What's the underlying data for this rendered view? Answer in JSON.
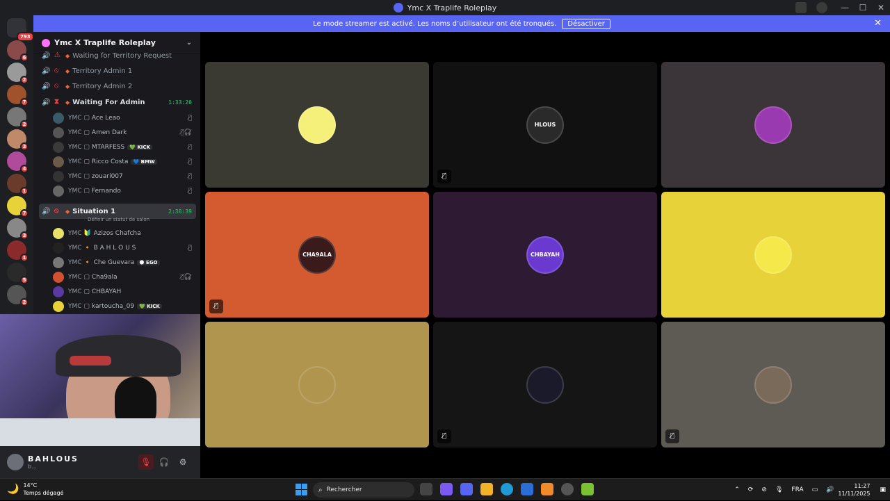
{
  "window": {
    "title": "Ymc X Traplife Roleplay"
  },
  "banner": {
    "message": "Le mode streamer est activé. Les noms d’utilisateur ont été tronqués.",
    "button": "Désactiver"
  },
  "rail": {
    "home_badge": "793",
    "servers": [
      {
        "badge": "6",
        "color": "#8a4a4a"
      },
      {
        "badge": "2",
        "color": "#9a9a9a"
      },
      {
        "badge": "7",
        "color": "#a0522d"
      },
      {
        "badge": "2",
        "color": "#777777"
      },
      {
        "badge": "3",
        "color": "#c08a6a"
      },
      {
        "badge": "4",
        "color": "#b04a9a"
      },
      {
        "badge": "1",
        "color": "#6a3a2a"
      },
      {
        "badge": "7",
        "color": "#e8d23a"
      },
      {
        "badge": "3",
        "color": "#888888"
      },
      {
        "badge": "1",
        "color": "#8a2a2a"
      },
      {
        "badge": "5",
        "color": "#2a2a2a"
      },
      {
        "badge": "2",
        "color": "#555555"
      }
    ]
  },
  "sidebar": {
    "server_name": "Ymc X Traplife Roleplay",
    "channels": [
      {
        "name": "Waiting for Territory Request",
        "status": "⚠",
        "timer": ""
      },
      {
        "name": "Territory Admin 1",
        "status": "⦸",
        "timer": ""
      },
      {
        "name": "Territory Admin 2",
        "status": "⦸",
        "timer": ""
      },
      {
        "name": "Waiting For Admin",
        "status": "⧗",
        "timer": "1:33:20"
      },
      {
        "name": "Situation 1",
        "status": "⦸",
        "timer": "2:38:39"
      }
    ],
    "situation_status": "Définir un statut de salon",
    "waiting_members": [
      {
        "tag": "YMC ▢",
        "nick": "Ace Leao",
        "pill": "",
        "mute": "🎙̸",
        "color": "#3a5a6a"
      },
      {
        "tag": "YMC ▢",
        "nick": "Amen Dark",
        "pill": "",
        "mute": "🎙̸🎧̸",
        "color": "#555"
      },
      {
        "tag": "YMC ▢",
        "nick": "MTARFESS",
        "pill": "💚 KICK",
        "mute": "🎙̸",
        "color": "#3a3a3a"
      },
      {
        "tag": "YMC ▢",
        "nick": "Ricco Costa",
        "pill": "💙 BMW",
        "mute": "🎙̸",
        "color": "#6a5a4a"
      },
      {
        "tag": "YMC ▢",
        "nick": "zouari007",
        "pill": "",
        "mute": "🎙̸",
        "color": "#333"
      },
      {
        "tag": "YMC ▢",
        "nick": "Fernando",
        "pill": "",
        "mute": "🎙̸",
        "color": "#666"
      }
    ],
    "situation_members": [
      {
        "tag": "YMC 🔰",
        "nick": "Azizos Chafcha",
        "pill": "",
        "mute": "",
        "color": "#e8e06a"
      },
      {
        "tag": "YMC 🔸",
        "nick": "B A H L O U S",
        "pill": "",
        "mute": "🎙̸",
        "color": "#222"
      },
      {
        "tag": "YMC 🔸",
        "nick": "Che Guevara",
        "pill": "🌑 EGO",
        "mute": "",
        "color": "#777"
      },
      {
        "tag": "YMC ▢",
        "nick": "Cha9ala",
        "pill": "",
        "mute": "🎙̸🎧̸",
        "color": "#d05030"
      },
      {
        "tag": "YMC ▢",
        "nick": "CHBAYAH",
        "pill": "",
        "mute": "",
        "color": "#5a3aa0"
      },
      {
        "tag": "YMC ▢",
        "nick": "kartoucha_09",
        "pill": "💚 KICK",
        "mute": "",
        "color": "#e8d23a"
      }
    ]
  },
  "user": {
    "name": "BAHLOUS",
    "status": "b..."
  },
  "grid": {
    "tiles": [
      {
        "bg": "#3a3a32",
        "pfp": "#f5f07a",
        "label": "",
        "muted": false
      },
      {
        "bg": "#111111",
        "pfp": "#2a2a2a",
        "label": "HLOUS",
        "muted": true
      },
      {
        "bg": "#3b3539",
        "pfp": "#9a3ab0",
        "label": "",
        "muted": false
      },
      {
        "bg": "#d45a30",
        "pfp": "#3a1a1a",
        "label": "CHA9ALA",
        "muted": true
      },
      {
        "bg": "#2e1a33",
        "pfp": "#6a3ad0",
        "label": "CHBAYAH",
        "muted": false
      },
      {
        "bg": "#e8d23a",
        "pfp": "#f5e84a",
        "label": "",
        "muted": false
      },
      {
        "bg": "#b0954f",
        "pfp": "#b0954f",
        "label": "",
        "muted": false
      },
      {
        "bg": "#151515",
        "pfp": "#1a1a2a",
        "label": "",
        "muted": true
      },
      {
        "bg": "#5e5b55",
        "pfp": "#7a6a5a",
        "label": "",
        "muted": true
      }
    ]
  },
  "taskbar": {
    "temp": "14°C",
    "weather": "Temps dégagé",
    "search": "Rechercher",
    "lang": "FRA",
    "time": "11:27",
    "date": "11/11/2025"
  }
}
